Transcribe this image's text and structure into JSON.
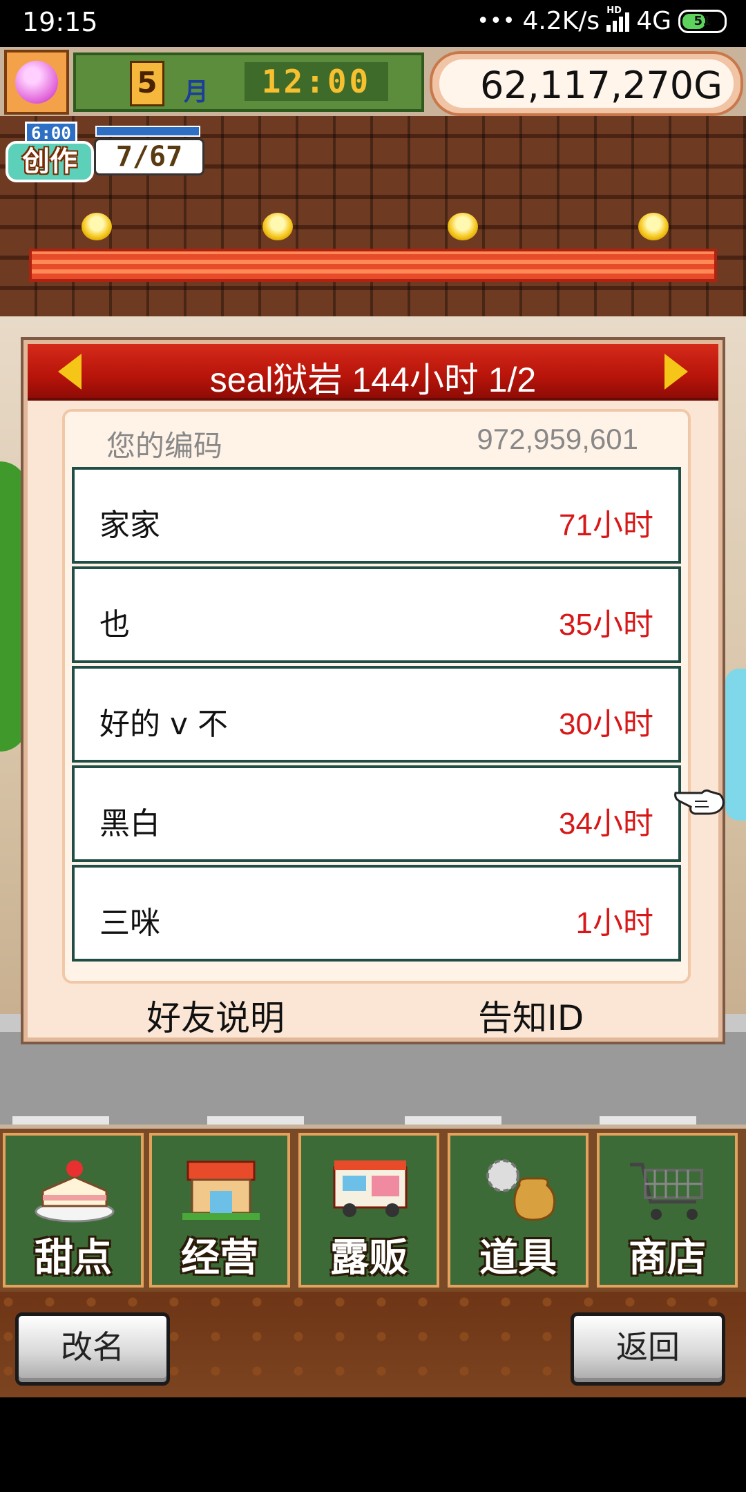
{
  "status_bar": {
    "time": "19:15",
    "dots": "•••",
    "network_speed": "4.2K/s",
    "hd": "HD",
    "network": "4G",
    "battery": "51"
  },
  "hud": {
    "month_number": "5",
    "month_label": "月",
    "clock": "12:00",
    "money": "62,117,270",
    "currency": "G",
    "create_time": "6:00",
    "create_label": "创作",
    "create_count": "7/67"
  },
  "dialog": {
    "title": "seal狱岩  144小时 1/2",
    "code_label": "您的编码",
    "code_value": "972,959,601",
    "friends": [
      {
        "name": "家家",
        "hours": "71小时"
      },
      {
        "name": "也",
        "hours": "35小时"
      },
      {
        "name": "好的 v 不",
        "hours": "30小时"
      },
      {
        "name": "黑白",
        "hours": "34小时"
      },
      {
        "name": "三咪",
        "hours": "1小时"
      }
    ],
    "footer_left": "好友说明",
    "footer_right": "告知ID"
  },
  "menu": {
    "items": [
      {
        "label": "甜点",
        "icon": "cake-icon"
      },
      {
        "label": "经营",
        "icon": "shop-icon"
      },
      {
        "label": "露贩",
        "icon": "food-truck-icon"
      },
      {
        "label": "道具",
        "icon": "item-bag-icon"
      },
      {
        "label": "商店",
        "icon": "cart-icon"
      }
    ]
  },
  "buttons": {
    "rename": "改名",
    "back": "返回"
  },
  "colors": {
    "header_red": "#b8140a",
    "hours_red": "#d81818",
    "menu_green": "#3d6b37",
    "row_border": "#1f4e46"
  }
}
